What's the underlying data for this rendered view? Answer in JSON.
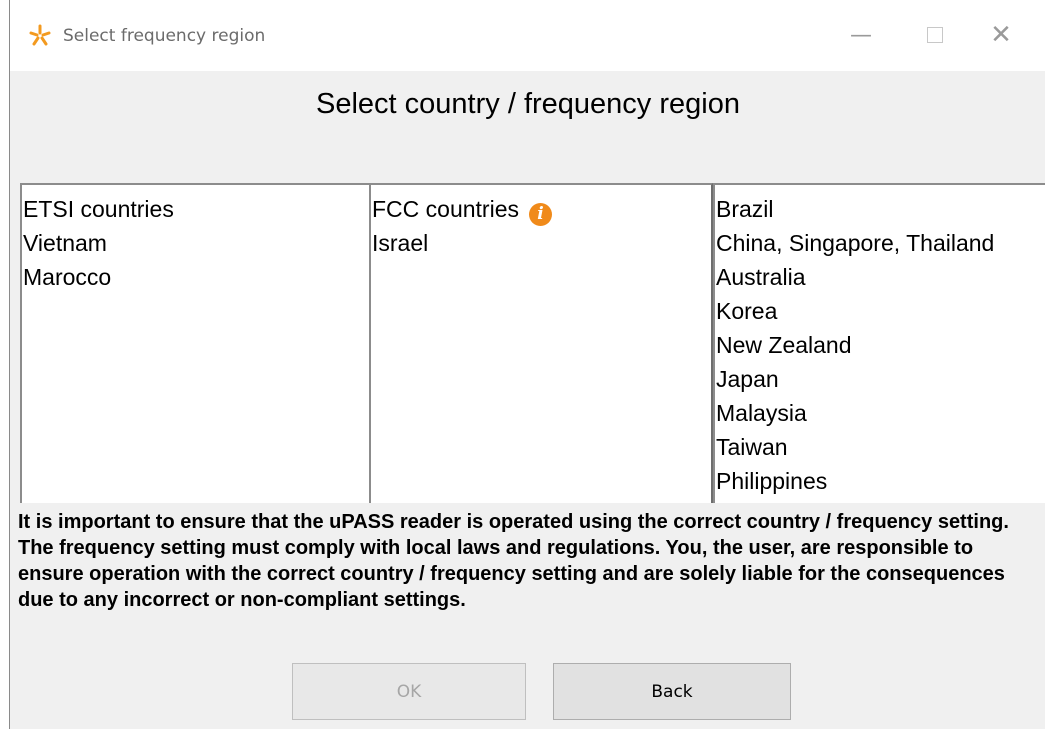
{
  "window": {
    "title": "Select frequency region",
    "icon": "orange-star-icon",
    "controls": {
      "minimize": "—",
      "close": "✕"
    }
  },
  "heading": "Select country / frequency region",
  "lists": {
    "column1": [
      "ETSI countries",
      "Vietnam",
      "Marocco"
    ],
    "column2": [
      "FCC countries",
      "Israel"
    ],
    "column2_info_icon": "i",
    "column3": [
      "Brazil",
      "China, Singapore, Thailand",
      "Australia",
      "Korea",
      "New Zealand",
      "Japan",
      "Malaysia",
      "Taiwan",
      "Philippines"
    ]
  },
  "notice": "It is important to ensure that the uPASS reader is operated using the correct country / frequency setting. The frequency setting must comply with local laws and regulations. You, the user, are responsible to ensure operation with the correct country / frequency setting and are solely liable for the consequences due to any incorrect or non-compliant settings.",
  "buttons": {
    "ok": "OK",
    "back": "Back"
  },
  "colors": {
    "accent": "#f08a1a",
    "window_bg": "#f0f0f0",
    "disabled_text": "#a6a6a6"
  }
}
